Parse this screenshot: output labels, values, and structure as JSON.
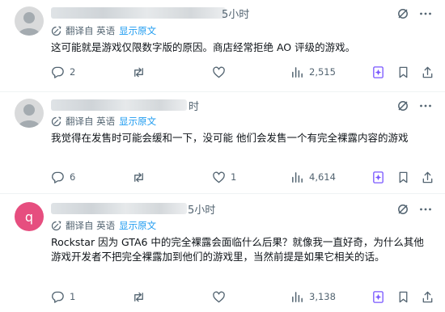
{
  "posts": [
    {
      "avatar": {
        "type": "silhouette"
      },
      "time_suffix": "5小时",
      "translation": {
        "label": "翻译自 英语",
        "show_original": "显示原文"
      },
      "text": "这可能就是游戏仅限数字版的原因。商店经常拒绝 AO 评级的游戏。",
      "stats": {
        "replies": "2",
        "reposts": "",
        "likes": "",
        "views": "2,515"
      }
    },
    {
      "avatar": {
        "type": "silhouette"
      },
      "time_suffix": "时",
      "translation": {
        "label": "翻译自 英语",
        "show_original": "显示原文"
      },
      "text": "我觉得在发售时可能会缓和一下，没可能    他们会发售一个有完全裸露内容的游戏",
      "stats": {
        "replies": "6",
        "reposts": "",
        "likes": "1",
        "views": "4,614"
      }
    },
    {
      "avatar": {
        "type": "letter",
        "letter": "q",
        "color": "#e64e7f"
      },
      "time_suffix": "5小时",
      "translation": {
        "label": "翻译自 英语",
        "show_original": "显示原文"
      },
      "text": "Rockstar 因为 GTA6 中的完全裸露会面临什么后果？就像我一直好奇，为什么其他游戏开发者不把完全裸露加到他们的游戏里，当然前提是如果它相关的话。",
      "stats": {
        "replies": "1",
        "reposts": "",
        "likes": "",
        "views": "3,138"
      }
    }
  ],
  "colors": {
    "accent": "#1d9bf0",
    "muted": "#536471",
    "grok": "#7856ff",
    "text": "#0f1419",
    "divider": "#eff3f4"
  },
  "icons": {
    "reply": "reply-icon",
    "repost": "repost-icon",
    "like": "like-icon",
    "views": "views-icon",
    "grok": "grok-icon",
    "bookmark": "bookmark-icon",
    "share": "share-icon",
    "more": "more-icon",
    "translate": "translate-icon"
  }
}
